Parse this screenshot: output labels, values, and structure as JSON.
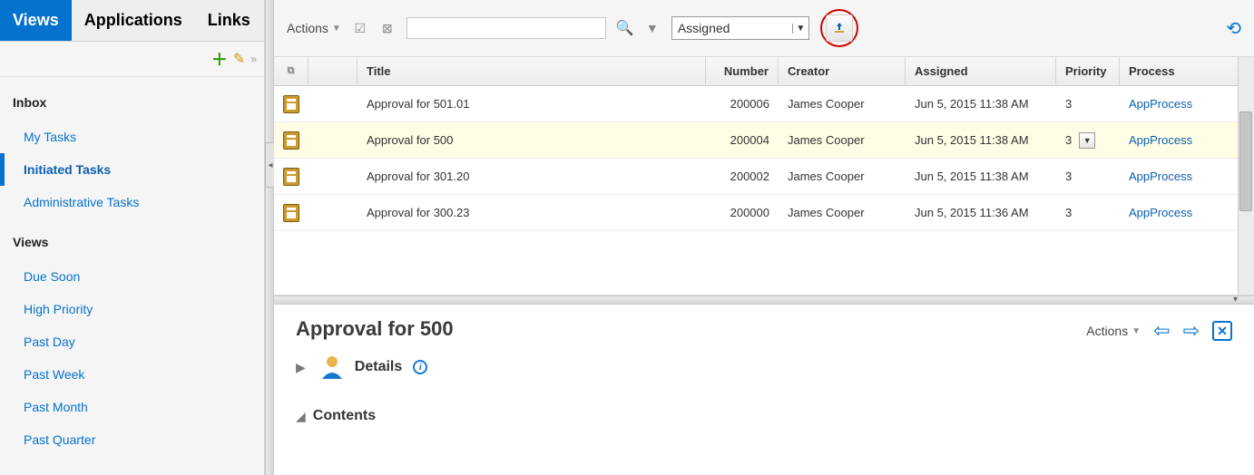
{
  "tabs": {
    "views": "Views",
    "applications": "Applications",
    "links": "Links"
  },
  "sidebar": {
    "inbox_heading": "Inbox",
    "inbox_items": [
      "My Tasks",
      "Initiated Tasks",
      "Administrative Tasks"
    ],
    "inbox_active_index": 1,
    "views_heading": "Views",
    "views_items": [
      "Due Soon",
      "High Priority",
      "Past Day",
      "Past Week",
      "Past Month",
      "Past Quarter"
    ]
  },
  "toolbar": {
    "actions_label": "Actions",
    "state_selected": "Assigned"
  },
  "table": {
    "headers": {
      "title": "Title",
      "number": "Number",
      "creator": "Creator",
      "assigned": "Assigned",
      "priority": "Priority",
      "process": "Process"
    },
    "selected_index": 1,
    "rows": [
      {
        "title": "Approval for 501.01",
        "number": "200006",
        "creator": "James Cooper",
        "assigned": "Jun 5, 2015 11:38 AM",
        "priority": "3",
        "process": "AppProcess"
      },
      {
        "title": "Approval for 500",
        "number": "200004",
        "creator": "James Cooper",
        "assigned": "Jun 5, 2015 11:38 AM",
        "priority": "3",
        "process": "AppProcess"
      },
      {
        "title": "Approval for 301.20",
        "number": "200002",
        "creator": "James Cooper",
        "assigned": "Jun 5, 2015 11:38 AM",
        "priority": "3",
        "process": "AppProcess"
      },
      {
        "title": "Approval for 300.23",
        "number": "200000",
        "creator": "James Cooper",
        "assigned": "Jun 5, 2015 11:36 AM",
        "priority": "3",
        "process": "AppProcess"
      }
    ]
  },
  "detail": {
    "title": "Approval for 500",
    "actions_label": "Actions",
    "details_label": "Details",
    "contents_label": "Contents"
  }
}
